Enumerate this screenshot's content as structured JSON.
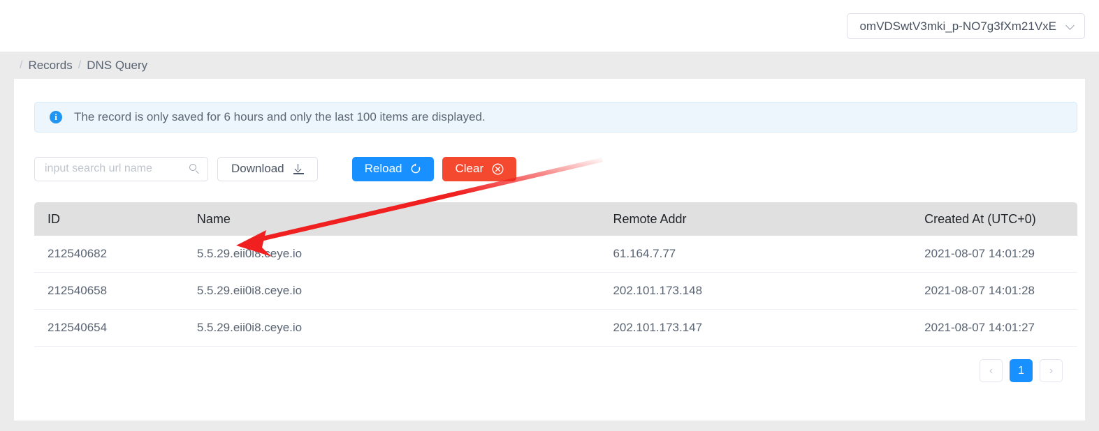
{
  "header": {
    "account_selector": {
      "value": "omVDSwtV3mki_p-NO7g3fXm21VxE",
      "chevron_icon": "chevron-down-icon"
    }
  },
  "breadcrumb": {
    "leading_separator": "/",
    "separator": "/",
    "items": [
      {
        "label": "Records"
      },
      {
        "label": "DNS Query"
      }
    ]
  },
  "alert": {
    "icon": "info-circle-icon",
    "message": "The record is only saved for 6 hours and only the last 100 items are displayed."
  },
  "toolbar": {
    "search": {
      "placeholder": "input search url name",
      "value": "",
      "icon": "search-icon"
    },
    "download_label": "Download",
    "download_icon": "download-icon",
    "reload_label": "Reload",
    "reload_icon": "refresh-icon",
    "clear_label": "Clear",
    "clear_icon": "close-circle-icon"
  },
  "table": {
    "columns": [
      "ID",
      "Name",
      "Remote Addr",
      "Created At (UTC+0)"
    ],
    "rows": [
      {
        "id": "212540682",
        "name": "5.5.29.eii0i8.ceye.io",
        "remote_addr": "61.164.7.77",
        "created_at": "2021-08-07 14:01:29"
      },
      {
        "id": "212540658",
        "name": "5.5.29.eii0i8.ceye.io",
        "remote_addr": "202.101.173.148",
        "created_at": "2021-08-07 14:01:28"
      },
      {
        "id": "212540654",
        "name": "5.5.29.eii0i8.ceye.io",
        "remote_addr": "202.101.173.147",
        "created_at": "2021-08-07 14:01:27"
      }
    ]
  },
  "pagination": {
    "prev_label": "‹",
    "next_label": "›",
    "pages": [
      "1"
    ],
    "current_page": "1"
  },
  "annotation": {
    "arrow_color": "#f02020",
    "description": "red-arrow-pointing-to-name-cell"
  },
  "colors": {
    "primary": "#1890ff",
    "danger": "#f4492f",
    "page_background": "#ebebeb",
    "card_background": "#ffffff",
    "table_header_background": "#e0e0e0",
    "alert_background": "#edf6fd"
  }
}
